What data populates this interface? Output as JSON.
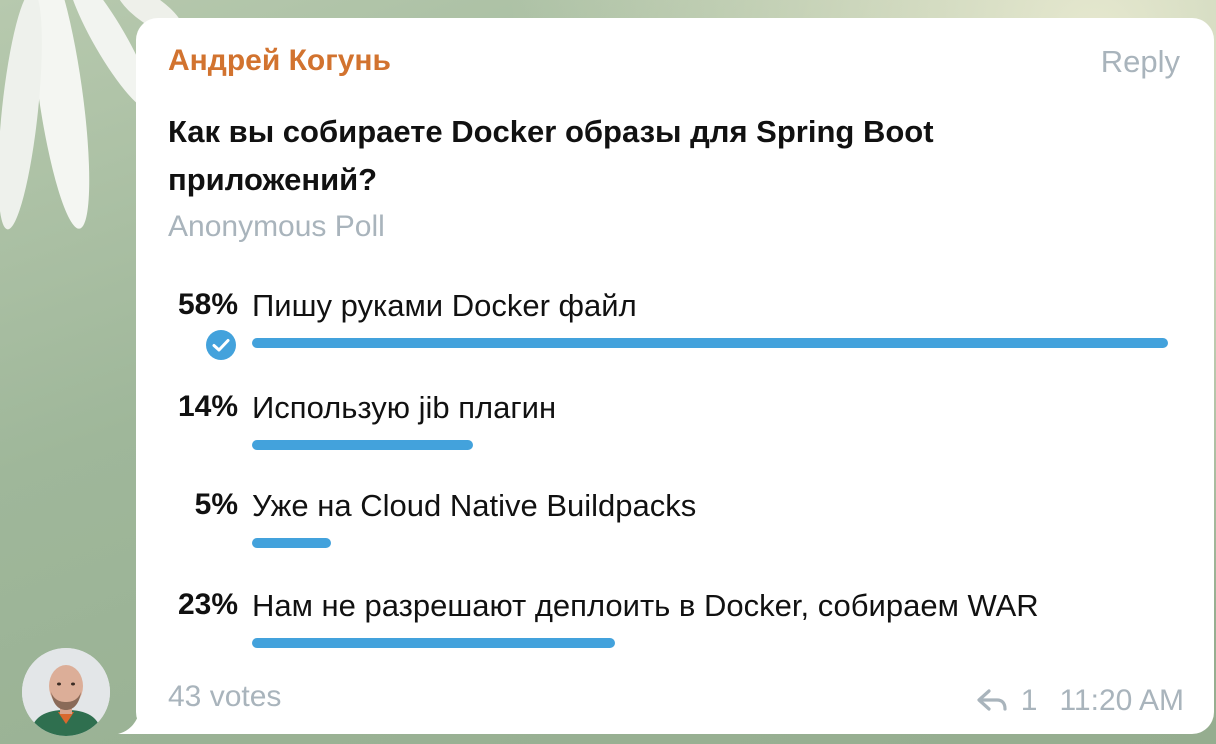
{
  "message": {
    "author": "Андрей Когунь",
    "reply_label": "Reply",
    "question": "Как вы собираете Docker образы для Spring Boot приложений?",
    "poll_type": "Anonymous Poll",
    "options": [
      {
        "percent_label": "58%",
        "percent": 58,
        "text": "Пишу руками Docker файл",
        "chosen": true
      },
      {
        "percent_label": "14%",
        "percent": 14,
        "text": "Использую jib плагин",
        "chosen": false
      },
      {
        "percent_label": "5%",
        "percent": 5,
        "text": "Уже на Cloud Native Buildpacks",
        "chosen": false
      },
      {
        "percent_label": "23%",
        "percent": 23,
        "text": "Нам не разрешают деплоить в Docker, собираем WAR",
        "chosen": false
      }
    ],
    "votes": "43 votes",
    "replies_count": "1",
    "time": "11:20 AM"
  },
  "colors": {
    "author": "#d2732f",
    "bar": "#43a2dc",
    "muted": "#a9b4bc",
    "bubble": "#ffffff"
  },
  "icons": {
    "chosen": "check-circle-icon",
    "replies": "reply-arrow-icon"
  }
}
